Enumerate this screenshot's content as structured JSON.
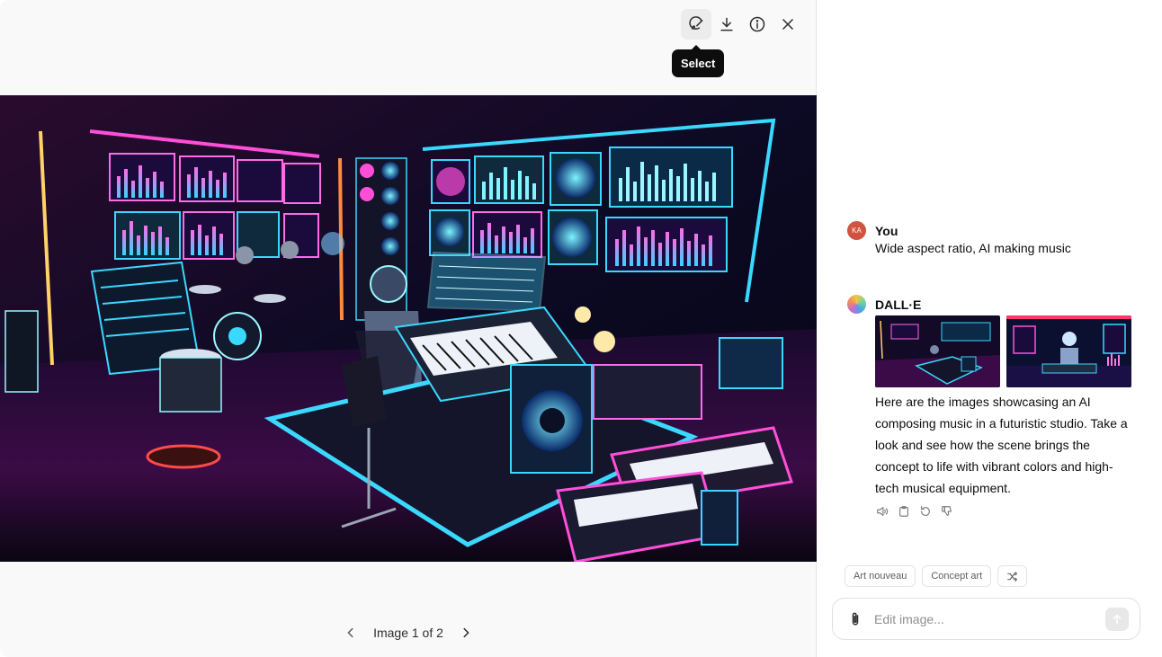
{
  "toolbar": {
    "select_icon": "select-brush-icon",
    "download_icon": "download-icon",
    "info_icon": "info-icon",
    "close_icon": "close-icon",
    "tooltip": "Select"
  },
  "viewer": {
    "pager_label": "Image 1 of 2",
    "prev_icon": "chevron-left-icon",
    "next_icon": "chevron-right-icon"
  },
  "conversation": {
    "user": {
      "initials": "KA",
      "name": "You",
      "text": "Wide aspect ratio, AI making music"
    },
    "assistant": {
      "name": "DALL·E",
      "text": "Here are the images showcasing an AI composing music in a futuristic studio. Take a look and see how the scene brings the concept to life with vibrant colors and high-tech musical equipment.",
      "actions": [
        "speaker-icon",
        "copy-icon",
        "regenerate-icon",
        "thumbs-down-icon"
      ]
    }
  },
  "chips": {
    "style_1": "Art nouveau",
    "style_2": "Concept art",
    "shuffle_icon": "shuffle-icon"
  },
  "composer": {
    "placeholder": "Edit image...",
    "attach_icon": "paperclip-icon",
    "send_icon": "arrow-up-icon"
  },
  "colors": {
    "tooltip_bg": "#0d0d0d",
    "user_avatar": "#d1523f",
    "neon_cyan": "#3ad8ff",
    "neon_pink": "#ff4fd8",
    "neon_purple": "#a14cff"
  }
}
